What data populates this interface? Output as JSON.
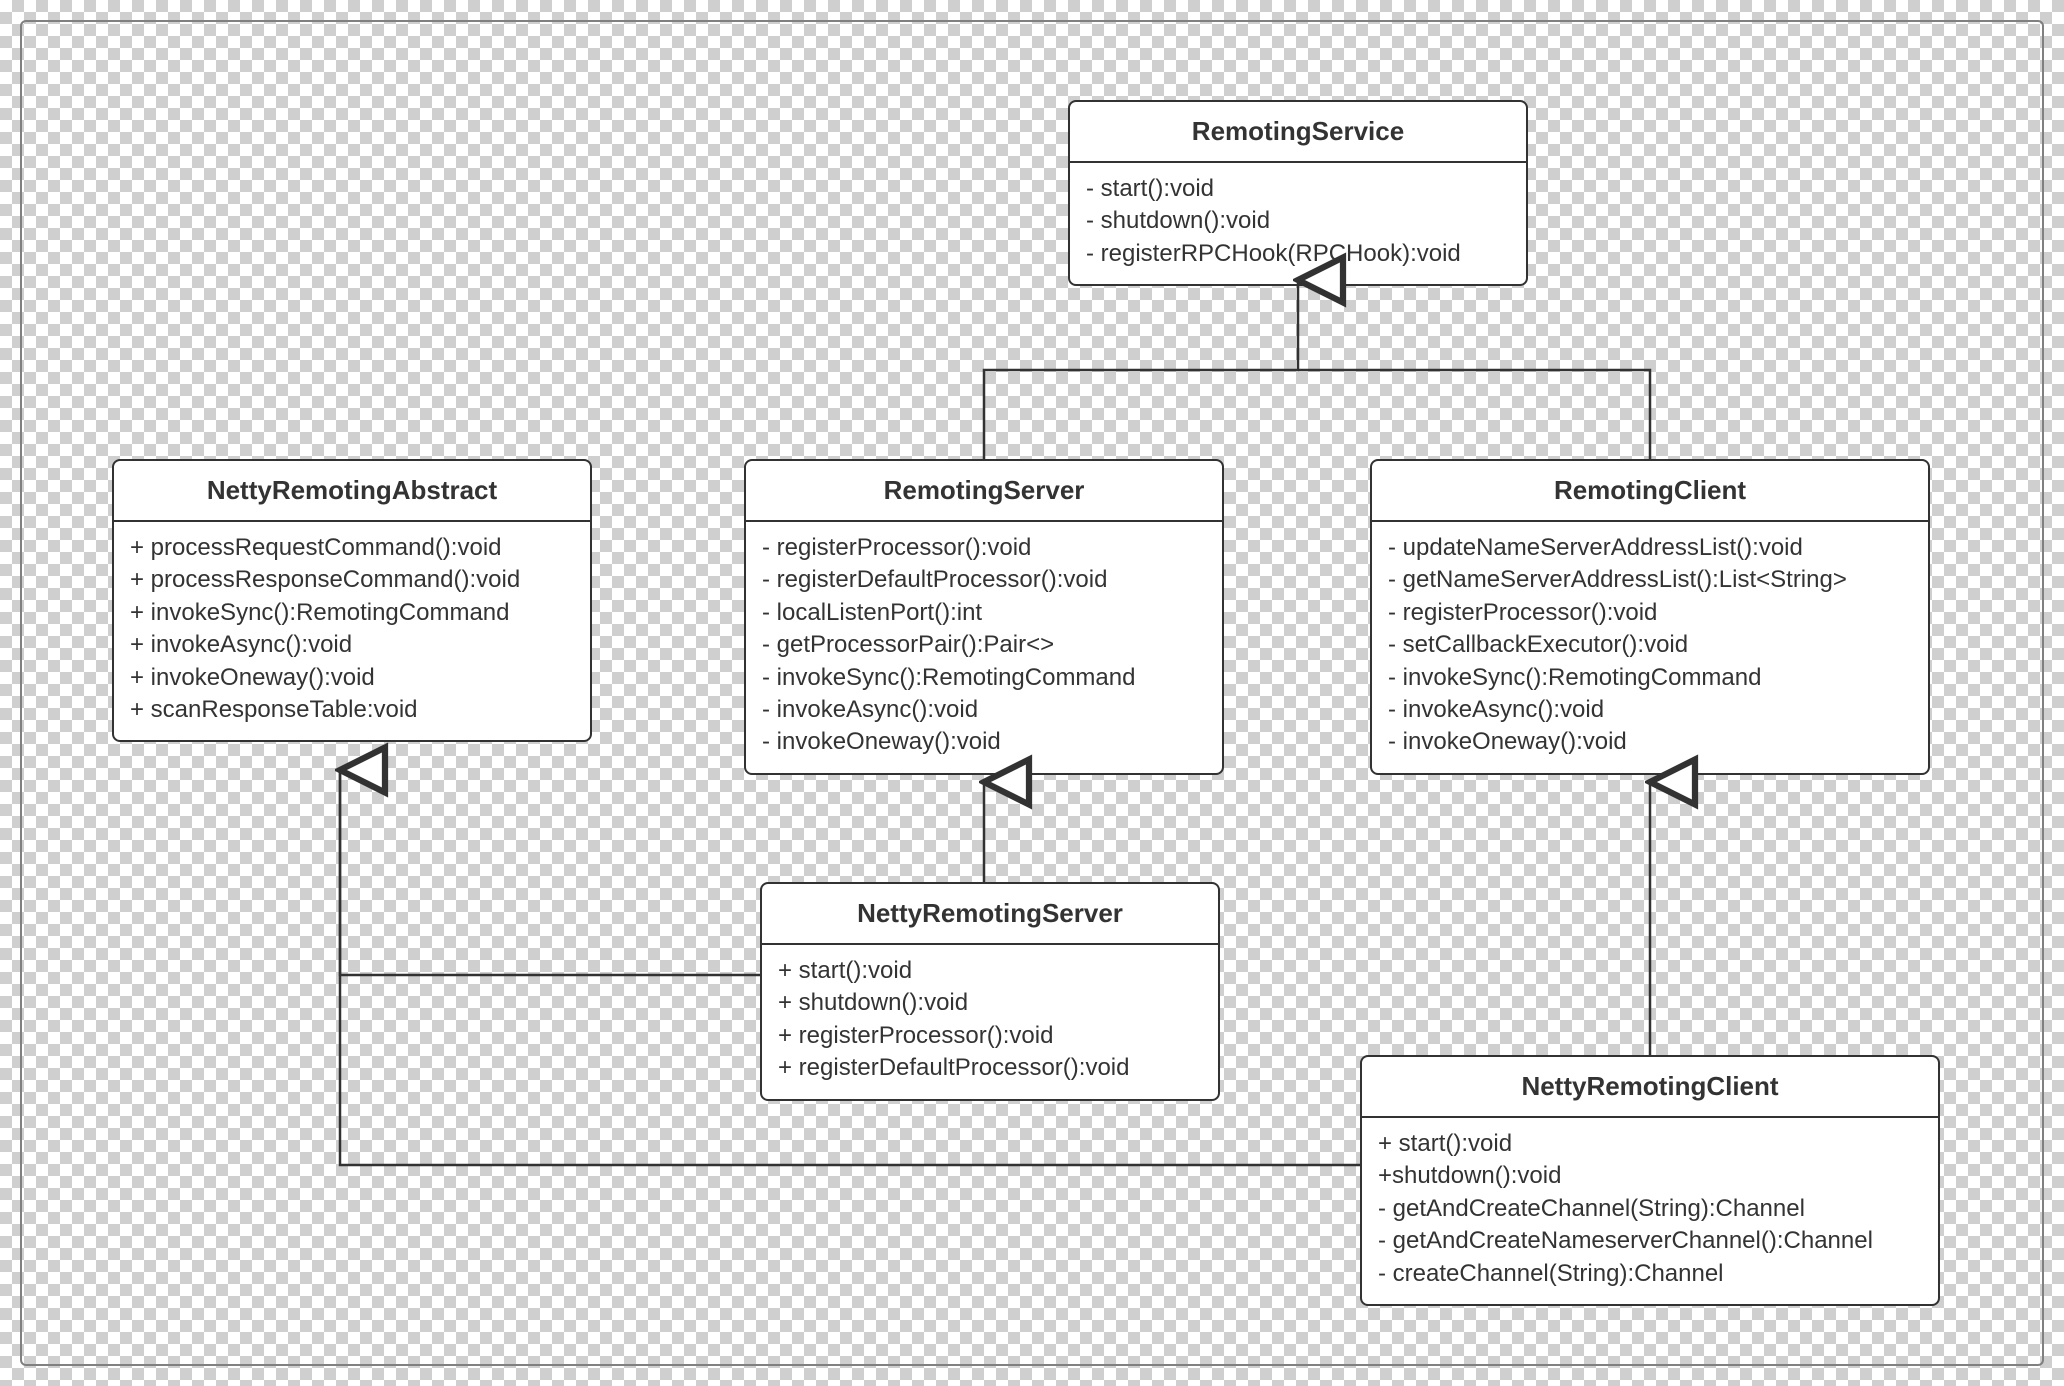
{
  "classes": {
    "RemotingService": {
      "name": "RemotingService",
      "members": [
        "- start():void",
        "- shutdown():void",
        "- registerRPCHook(RPCHook):void"
      ]
    },
    "NettyRemotingAbstract": {
      "name": "NettyRemotingAbstract",
      "members": [
        "+ processRequestCommand():void",
        "+ processResponseCommand():void",
        "+ invokeSync():RemotingCommand",
        "+ invokeAsync():void",
        "+ invokeOneway():void",
        "+ scanResponseTable:void"
      ]
    },
    "RemotingServer": {
      "name": "RemotingServer",
      "members": [
        "- registerProcessor():void",
        "- registerDefaultProcessor():void",
        "- localListenPort():int",
        "- getProcessorPair():Pair<>",
        "- invokeSync():RemotingCommand",
        "- invokeAsync():void",
        "- invokeOneway():void"
      ]
    },
    "RemotingClient": {
      "name": "RemotingClient",
      "members": [
        "- updateNameServerAddressList():void",
        "- getNameServerAddressList():List<String>",
        "- registerProcessor():void",
        "- setCallbackExecutor():void",
        "- invokeSync():RemotingCommand",
        "- invokeAsync():void",
        "- invokeOneway():void"
      ]
    },
    "NettyRemotingServer": {
      "name": "NettyRemotingServer",
      "members": [
        "+ start():void",
        "+ shutdown():void",
        "+ registerProcessor():void",
        "+ registerDefaultProcessor():void"
      ]
    },
    "NettyRemotingClient": {
      "name": "NettyRemotingClient",
      "members": [
        "+ start():void",
        "+shutdown():void",
        "- getAndCreateChannel(String):Channel",
        "- getAndCreateNameserverChannel():Channel",
        "- createChannel(String):Channel"
      ]
    }
  }
}
